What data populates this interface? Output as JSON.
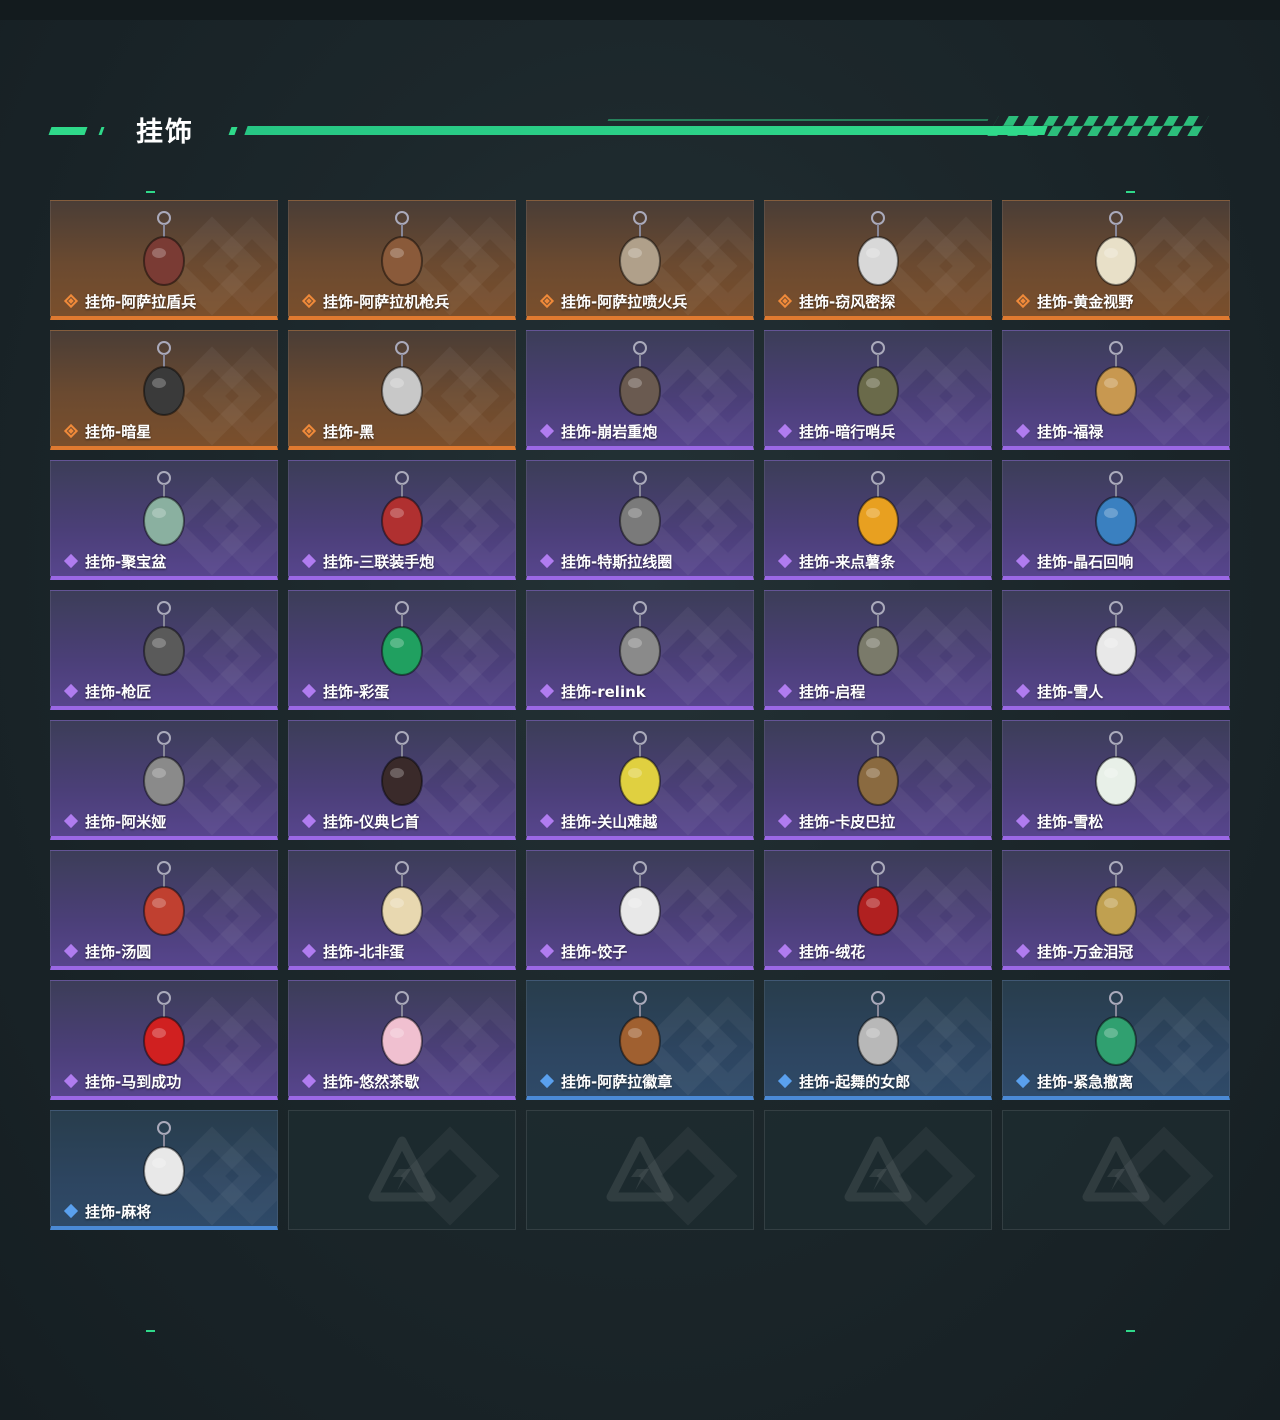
{
  "section": {
    "title": "挂饰"
  },
  "colors": {
    "accent": "#2fd98a",
    "legendary": "#e07a30",
    "epic": "#9b68e6",
    "rare": "#4b8ad6"
  },
  "items": [
    {
      "label": "挂饰-阿萨拉盾兵",
      "rarity": "legendary",
      "icon": "robot-soldier-icon"
    },
    {
      "label": "挂饰-阿萨拉机枪兵",
      "rarity": "legendary",
      "icon": "robot-gunner-icon"
    },
    {
      "label": "挂饰-阿萨拉喷火兵",
      "rarity": "legendary",
      "icon": "flamethrower-soldier-icon"
    },
    {
      "label": "挂饰-窃风密探",
      "rarity": "legendary",
      "icon": "rabbit-figure-icon"
    },
    {
      "label": "挂饰-黄金视野",
      "rarity": "legendary",
      "icon": "white-creature-icon"
    },
    {
      "label": "挂饰-暗星",
      "rarity": "legendary",
      "icon": "cloaked-figure-icon"
    },
    {
      "label": "挂饰-黑",
      "rarity": "legendary",
      "icon": "card-tag-icon"
    },
    {
      "label": "挂饰-崩岩重炮",
      "rarity": "epic",
      "icon": "heavy-soldier-icon"
    },
    {
      "label": "挂饰-暗行哨兵",
      "rarity": "epic",
      "icon": "sentry-soldier-icon"
    },
    {
      "label": "挂饰-福禄",
      "rarity": "epic",
      "icon": "gourd-icon"
    },
    {
      "label": "挂饰-聚宝盆",
      "rarity": "epic",
      "icon": "treasure-bowl-icon"
    },
    {
      "label": "挂饰-三联装手炮",
      "rarity": "epic",
      "icon": "hand-cannon-icon"
    },
    {
      "label": "挂饰-特斯拉线圈",
      "rarity": "epic",
      "icon": "tesla-coil-icon"
    },
    {
      "label": "挂饰-来点薯条",
      "rarity": "epic",
      "icon": "fries-icon"
    },
    {
      "label": "挂饰-晶石回响",
      "rarity": "epic",
      "icon": "crystal-icon"
    },
    {
      "label": "挂饰-枪匠",
      "rarity": "epic",
      "icon": "gunsmith-badge-icon"
    },
    {
      "label": "挂饰-彩蛋",
      "rarity": "epic",
      "icon": "egg-icon"
    },
    {
      "label": "挂饰-relink",
      "rarity": "epic",
      "icon": "relink-medal-icon"
    },
    {
      "label": "挂饰-启程",
      "rarity": "epic",
      "icon": "compass-medal-icon"
    },
    {
      "label": "挂饰-雪人",
      "rarity": "epic",
      "icon": "snowman-icon"
    },
    {
      "label": "挂饰-阿米娅",
      "rarity": "epic",
      "icon": "bunny-doll-icon"
    },
    {
      "label": "挂饰-仪典匕首",
      "rarity": "epic",
      "icon": "dagger-icon"
    },
    {
      "label": "挂饰-关山难越",
      "rarity": "epic",
      "icon": "canister-icon"
    },
    {
      "label": "挂饰-卡皮巴拉",
      "rarity": "epic",
      "icon": "capybara-icon"
    },
    {
      "label": "挂饰-雪松",
      "rarity": "epic",
      "icon": "pine-tree-icon"
    },
    {
      "label": "挂饰-汤圆",
      "rarity": "epic",
      "icon": "dumpling-bowl-icon"
    },
    {
      "label": "挂饰-北非蛋",
      "rarity": "epic",
      "icon": "shakshuka-icon"
    },
    {
      "label": "挂饰-饺子",
      "rarity": "epic",
      "icon": "dumplings-plate-icon"
    },
    {
      "label": "挂饰-绒花",
      "rarity": "epic",
      "icon": "flower-icon"
    },
    {
      "label": "挂饰-万金泪冠",
      "rarity": "epic",
      "icon": "crown-icon"
    },
    {
      "label": "挂饰-马到成功",
      "rarity": "epic",
      "icon": "horse-icon"
    },
    {
      "label": "挂饰-悠然茶歇",
      "rarity": "epic",
      "icon": "cupcake-icon"
    },
    {
      "label": "挂饰-阿萨拉徽章",
      "rarity": "rare",
      "icon": "emblem-icon"
    },
    {
      "label": "挂饰-起舞的女郎",
      "rarity": "rare",
      "icon": "dancer-icon"
    },
    {
      "label": "挂饰-紧急撤离",
      "rarity": "rare",
      "icon": "evac-sign-icon"
    },
    {
      "label": "挂饰-麻将",
      "rarity": "rare",
      "icon": "mahjong-tile-icon"
    }
  ],
  "empty_slot_count": 4
}
